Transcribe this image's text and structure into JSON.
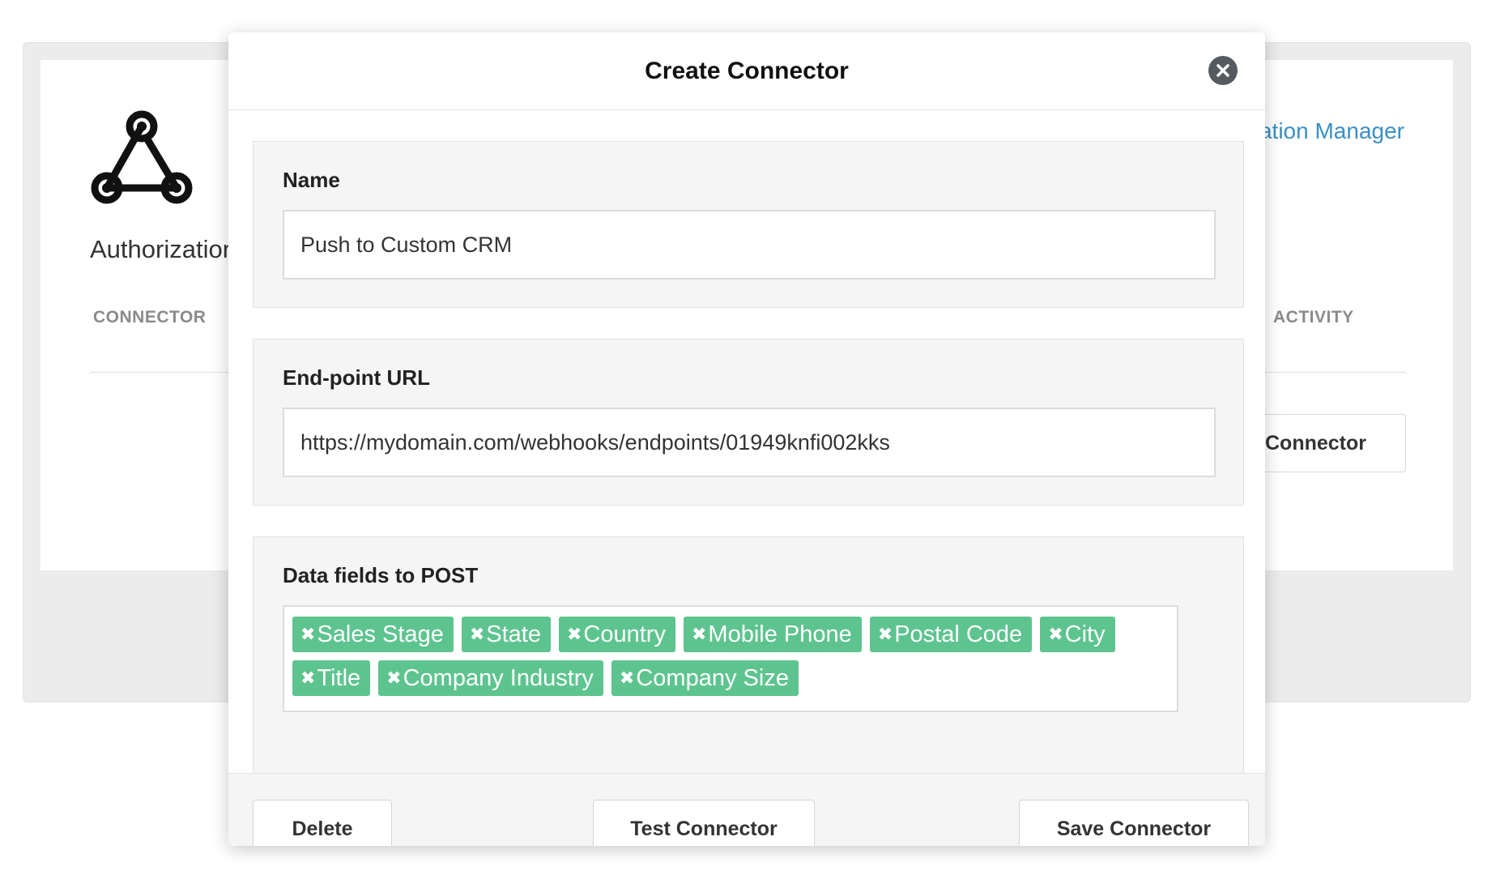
{
  "background": {
    "title": "Authorization",
    "link_text": "ation Manager",
    "columns": {
      "connector": "CONNECTOR",
      "activity": "ACTIVITY"
    },
    "button_label": "Connector"
  },
  "modal": {
    "title": "Create Connector",
    "close_icon": "close-icon",
    "name_section": {
      "label": "Name",
      "value": "Push to Custom CRM"
    },
    "url_section": {
      "label": "End-point URL",
      "value": "https://mydomain.com/webhooks/endpoints/01949knfi002kks"
    },
    "fields_section": {
      "label": "Data fields to POST",
      "tags": [
        "Sales Stage",
        "State",
        "Country",
        "Mobile Phone",
        "Postal Code",
        "City",
        "Title",
        "Company Industry",
        "Company Size"
      ],
      "remove_glyph": "✖",
      "tag_color": "#5ec48f"
    },
    "footer": {
      "delete_label": "Delete",
      "test_label": "Test Connector",
      "save_label": "Save Connector"
    }
  }
}
